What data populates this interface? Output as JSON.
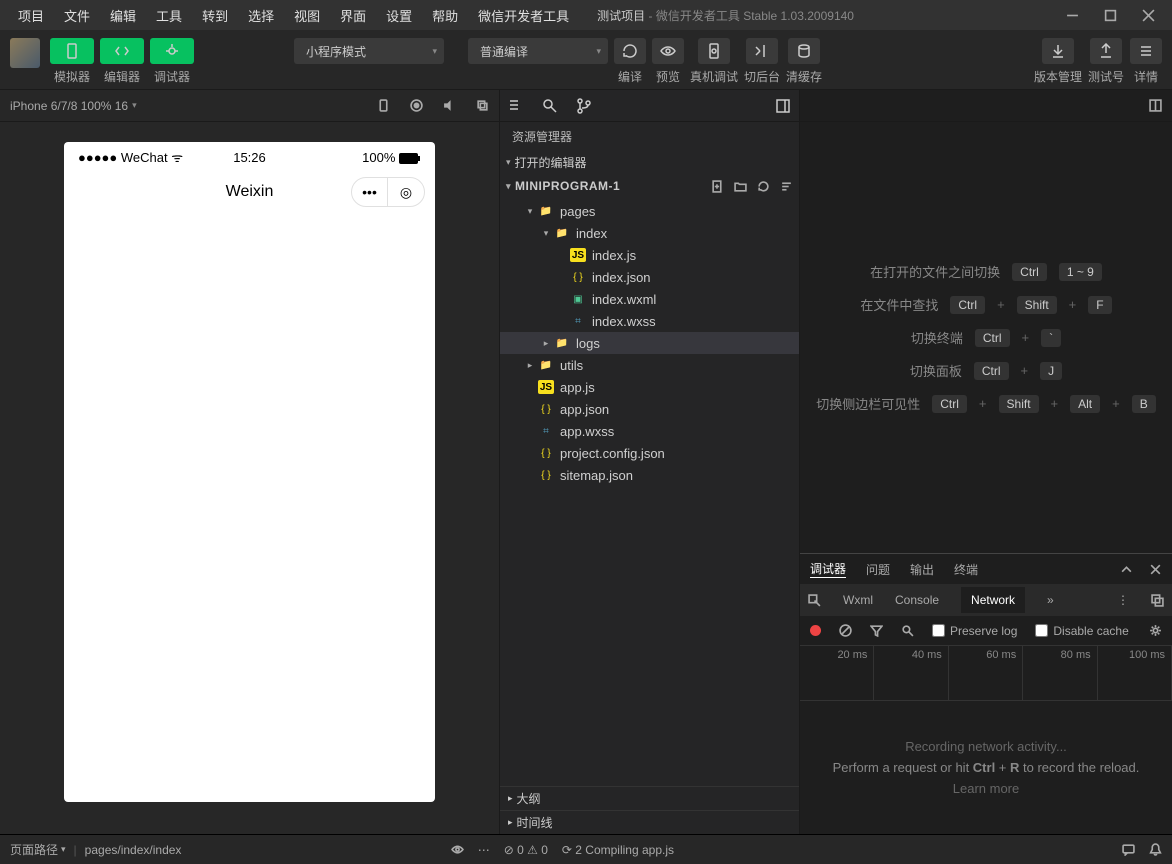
{
  "menu": [
    "项目",
    "文件",
    "编辑",
    "工具",
    "转到",
    "选择",
    "视图",
    "界面",
    "设置",
    "帮助",
    "微信开发者工具"
  ],
  "title": {
    "project": "测试项目",
    "app": "微信开发者工具 Stable 1.03.2009140"
  },
  "toolbar": {
    "labels": {
      "simulator": "模拟器",
      "editor": "编辑器",
      "debugger": "调试器"
    },
    "mode": "小程序模式",
    "compile": "普通编译",
    "actions": {
      "compile": "编译",
      "preview": "预览",
      "real": "真机调试",
      "back": "切后台",
      "cache": "清缓存"
    },
    "right": {
      "version": "版本管理",
      "test": "测试号",
      "detail": "详情"
    }
  },
  "simulator": {
    "device": "iPhone 6/7/8 100% 16",
    "status": {
      "signal": "●●●●● WeChat",
      "wifi": "ᯤ",
      "time": "15:26",
      "battery": "100%"
    },
    "navTitle": "Weixin"
  },
  "explorer": {
    "title": "资源管理器",
    "openEditors": "打开的编辑器",
    "project": "MINIPROGRAM-1",
    "items": [
      {
        "type": "folder",
        "name": "pages",
        "indent": 1,
        "open": true
      },
      {
        "type": "folder",
        "name": "index",
        "indent": 2,
        "open": true
      },
      {
        "type": "file",
        "name": "index.js",
        "indent": 3,
        "icon": "js"
      },
      {
        "type": "file",
        "name": "index.json",
        "indent": 3,
        "icon": "json"
      },
      {
        "type": "file",
        "name": "index.wxml",
        "indent": 3,
        "icon": "wxml"
      },
      {
        "type": "file",
        "name": "index.wxss",
        "indent": 3,
        "icon": "wxss"
      },
      {
        "type": "folder",
        "name": "logs",
        "indent": 2,
        "open": false,
        "selected": true
      },
      {
        "type": "folder",
        "name": "utils",
        "indent": 1,
        "open": false
      },
      {
        "type": "file",
        "name": "app.js",
        "indent": 1,
        "icon": "js"
      },
      {
        "type": "file",
        "name": "app.json",
        "indent": 1,
        "icon": "json"
      },
      {
        "type": "file",
        "name": "app.wxss",
        "indent": 1,
        "icon": "wxss"
      },
      {
        "type": "file",
        "name": "project.config.json",
        "indent": 1,
        "icon": "json"
      },
      {
        "type": "file",
        "name": "sitemap.json",
        "indent": 1,
        "icon": "json"
      }
    ],
    "outline": "大纲",
    "timeline": "时间线"
  },
  "hints": [
    {
      "text": "在打开的文件之间切换",
      "keys": [
        "Ctrl",
        "1 ~ 9"
      ]
    },
    {
      "text": "在文件中查找",
      "keys": [
        "Ctrl",
        "+",
        "Shift",
        "+",
        "F"
      ]
    },
    {
      "text": "切换终端",
      "keys": [
        "Ctrl",
        "+",
        "`"
      ]
    },
    {
      "text": "切换面板",
      "keys": [
        "Ctrl",
        "+",
        "J"
      ]
    },
    {
      "text": "切换侧边栏可见性",
      "keys": [
        "Ctrl",
        "+",
        "Shift",
        "+",
        "Alt",
        "+",
        "B"
      ]
    }
  ],
  "debugger": {
    "tabs": [
      "调试器",
      "问题",
      "输出",
      "终端"
    ],
    "devtabs": [
      "Wxml",
      "Console",
      "Network"
    ],
    "preserveLog": "Preserve log",
    "disableCache": "Disable cache",
    "timeline": [
      "20 ms",
      "40 ms",
      "60 ms",
      "80 ms",
      "100 ms"
    ],
    "msg1": "Recording network activity...",
    "msg2a": "Perform a request or hit ",
    "msg2b": "Ctrl",
    "msg2c": " + ",
    "msg2d": "R",
    "msg2e": " to record the reload.",
    "learn": "Learn more"
  },
  "statusBar": {
    "pathLabel": "页面路径",
    "path": "pages/index/index",
    "errors": "0",
    "warnings": "0",
    "compiling": "2 Compiling app.js"
  }
}
